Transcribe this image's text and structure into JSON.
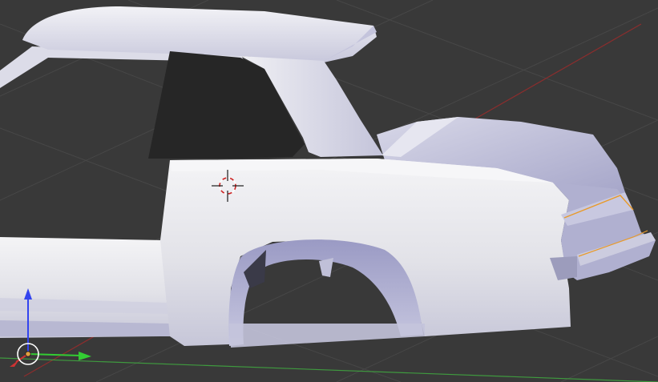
{
  "viewport": {
    "background_color": "#393939",
    "grid_line_color": "#4a4a4a",
    "x_axis_color": "#8c2d2d",
    "y_axis_color": "#3f9a3f",
    "model_base_color": "#e4e4ec",
    "model_shadow_color": "#aaaacc",
    "window_glass_color": "#262626",
    "selection_edge_color": "#e89a2a",
    "cursor_color": "#cc2222"
  },
  "gizmo": {
    "x_arrow_color": "#cc3333",
    "y_arrow_color": "#33cc33",
    "z_arrow_color": "#3344ee",
    "center_color": "#e0a040"
  },
  "icons": {
    "cursor": "3d-cursor-icon",
    "gizmo": "transform-manipulator-icon"
  }
}
